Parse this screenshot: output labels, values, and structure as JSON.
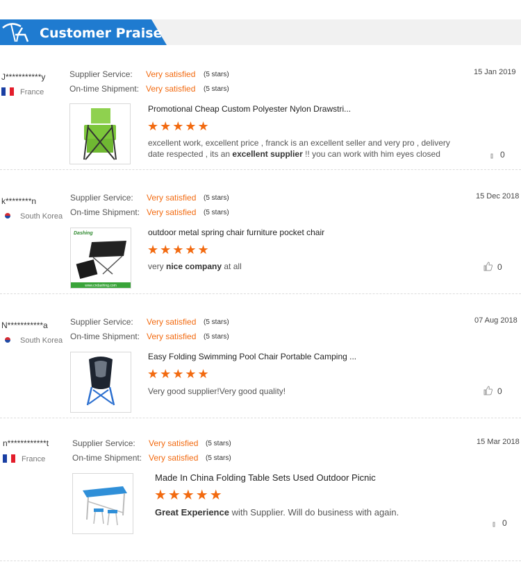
{
  "header": {
    "title": "Customer Praise",
    "accent": "#1f7bd0"
  },
  "labels": {
    "supplier_service": "Supplier Service:",
    "on_time": "On-time Shipment:"
  },
  "reviews": [
    {
      "user": "J***********y",
      "country": "France",
      "flag": "flag-fr",
      "service": "Very satisfied",
      "service_stars": "(5 stars)",
      "shipment": "Very satisfied",
      "shipment_stars": "(5 stars)",
      "date": "15 Jan 2019",
      "product": "Promotional Cheap Custom Polyester Nylon Drawstri...",
      "rating": 5,
      "comment_pre": "excellent work, excellent price , franck is an excellent seller and very pro , delivery date respected , its an ",
      "comment_bold": "excellent supplier",
      "comment_post": " !! you can work with him eyes closed",
      "likes": "0"
    },
    {
      "user": "k********n",
      "country": "South Korea",
      "flag": "flag-kr",
      "service": "Very satisfied",
      "service_stars": "(5 stars)",
      "shipment": "Very satisfied",
      "shipment_stars": "(5 stars)",
      "date": "15 Dec 2018",
      "product": "outdoor metal spring chair furniture pocket chair",
      "rating": 5,
      "comment_pre": "very ",
      "comment_bold": "nice company",
      "comment_post": " at all",
      "likes": "0"
    },
    {
      "user": "N***********a",
      "country": "South Korea",
      "flag": "flag-kr",
      "service": "Very satisfied",
      "service_stars": "(5 stars)",
      "shipment": "Very satisfied",
      "shipment_stars": "(5 stars)",
      "date": "07 Aug 2018",
      "product": "Easy Folding Swimming Pool Chair Portable Camping ...",
      "rating": 5,
      "comment_pre": "Very good supplier!Very good quality!",
      "comment_bold": "",
      "comment_post": "",
      "likes": "0"
    },
    {
      "user": "n************t",
      "country": "France",
      "flag": "flag-fr",
      "service": "Very satisfied",
      "service_stars": "(5 stars)",
      "shipment": "Very satisfied",
      "shipment_stars": "(5 stars)",
      "date": "15 Mar 2018",
      "product": "Made In China Folding Table Sets Used Outdoor Picnic",
      "rating": 5,
      "comment_pre": "",
      "comment_bold": "Great Experience",
      "comment_post": " with Supplier.  Will do business with again.",
      "likes": "0"
    }
  ],
  "thumbnails": [
    {
      "icon": "green-cooler-chair-image"
    },
    {
      "icon": "pocket-chair-image",
      "brand": "Dashing",
      "caption": "www.cndashing.com"
    },
    {
      "icon": "camping-chair-image"
    },
    {
      "icon": "folding-table-set-image"
    }
  ],
  "star_char": "★★★★★"
}
